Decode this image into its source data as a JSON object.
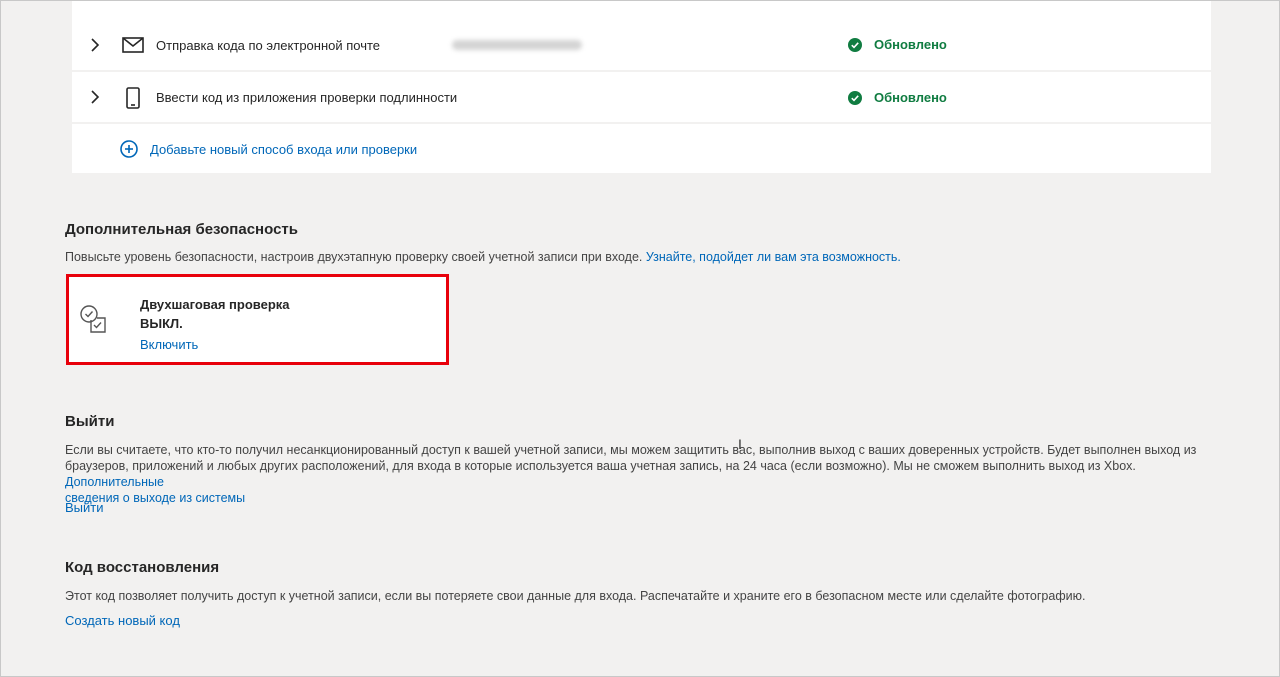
{
  "methods": {
    "email": {
      "label": "Отправка кода по электронной почте",
      "status": "Обновлено"
    },
    "app": {
      "label": "Ввести код из приложения проверки подлинности",
      "status": "Обновлено"
    },
    "add_link": "Добавьте новый способ входа или проверки"
  },
  "extra_security": {
    "title": "Дополнительная безопасность",
    "description": "Повысьте уровень безопасности, настроив двухэтапную проверку своей учетной записи при входе.",
    "learn_link": "Узнайте, подойдет ли вам эта возможность.",
    "two_step": {
      "title": "Двухшаговая проверка",
      "status": "ВЫКЛ.",
      "enable_link": "Включить"
    }
  },
  "signout": {
    "title": "Выйти",
    "text_line1": "Если вы считаете, что кто-то получил несанкционированный доступ к вашей учетной записи, мы можем защитить вас, выполнив выход с ваших доверенных устройств. Будет выполнен выход из",
    "text_line2": "браузеров, приложений и любых других расположений, для входа в которые используется ваша учетная запись, на 24 часа (если возможно). Мы не сможем выполнить выход из Xbox.",
    "more_link_part1": "Дополнительные",
    "more_link_part2": "сведения о выходе из системы",
    "action_link": "Выйти"
  },
  "recovery": {
    "title": "Код восстановления",
    "text": "Этот код позволяет получить доступ к учетной записи, если вы потеряете свои данные для входа. Распечатайте и храните его в безопасном месте или сделайте фотографию.",
    "action_link": "Создать новый код"
  },
  "colors": {
    "link": "#0067b8",
    "success": "#107c41",
    "highlight": "#e8000b",
    "background": "#f2f1f0"
  },
  "icons": [
    "chevron-right-icon",
    "mail-icon",
    "phone-icon",
    "check-circle-icon",
    "plus-circle-icon",
    "two-step-icon"
  ]
}
